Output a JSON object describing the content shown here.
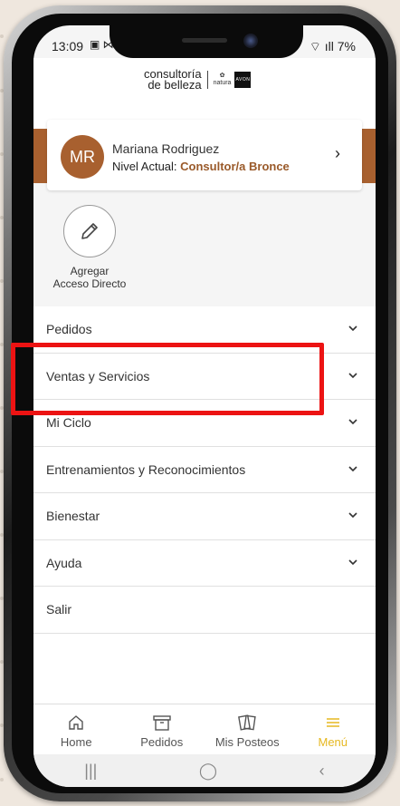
{
  "status_bar": {
    "time": "13:09",
    "time_icons": "▣ ⋈",
    "battery": "7%"
  },
  "brand": {
    "line1": "consultoría",
    "line2": "de belleza",
    "partner1": "natura",
    "partner2": "AVON"
  },
  "profile": {
    "initials": "MR",
    "name": "Mariana Rodriguez",
    "level_prefix": "Nivel Actual: ",
    "level": "Consultor/a Bronce",
    "chevron": "›"
  },
  "shortcut": {
    "label_line1": "Agregar",
    "label_line2": "Acceso Directo"
  },
  "menu": {
    "items": [
      {
        "label": "Pedidos"
      },
      {
        "label": "Ventas y Servicios"
      },
      {
        "label": "Mi Ciclo"
      },
      {
        "label": "Entrenamientos y Reconocimientos"
      },
      {
        "label": "Bienestar"
      },
      {
        "label": "Ayuda"
      },
      {
        "label": "Salir"
      }
    ]
  },
  "bottom_nav": {
    "items": [
      {
        "label": "Home",
        "icon": "home-icon"
      },
      {
        "label": "Pedidos",
        "icon": "box-icon"
      },
      {
        "label": "Mis Posteos",
        "icon": "posts-icon"
      },
      {
        "label": "Menú",
        "icon": "hamburger-icon"
      }
    ]
  },
  "android_nav": {
    "recents": "|||",
    "home": "◯",
    "back": "‹"
  },
  "colors": {
    "brand_brown": "#a8602f",
    "active_nav": "#e6b820",
    "highlight": "#ec1313"
  }
}
